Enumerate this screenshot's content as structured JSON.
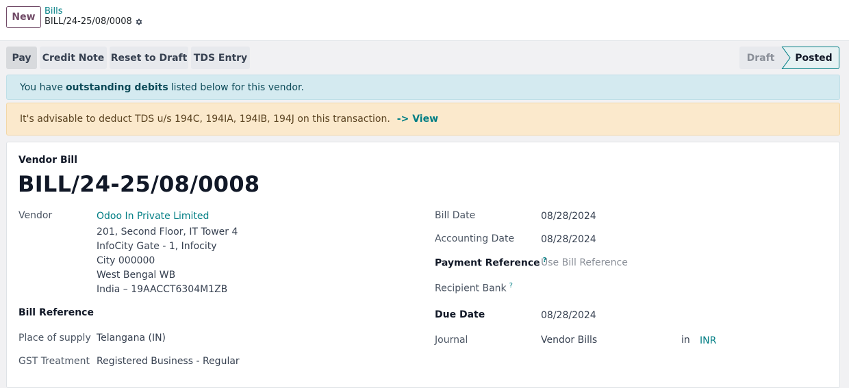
{
  "topbar": {
    "new_label": "New",
    "breadcrumb_parent": "Bills",
    "breadcrumb_current": "BILL/24-25/08/0008"
  },
  "actions": {
    "pay": "Pay",
    "credit_note": "Credit Note",
    "reset_to_draft": "Reset to Draft",
    "tds_entry": "TDS Entry"
  },
  "status": {
    "draft": "Draft",
    "posted": "Posted"
  },
  "alerts": {
    "info_prefix": "You have",
    "info_bold": "outstanding debits",
    "info_suffix": "listed below for this vendor.",
    "tds_text": "It's advisable to deduct TDS u/s 194C, 194IA, 194IB, 194J on this transaction.",
    "tds_link": "-> View"
  },
  "form": {
    "subtitle": "Vendor Bill",
    "title": "BILL/24-25/08/0008",
    "vendor_label": "Vendor",
    "vendor_name": "Odoo In Private Limited",
    "vendor_address": [
      "201, Second Floor, IT Tower 4",
      "InfoCity Gate - 1, Infocity",
      "City 000000",
      "West Bengal WB",
      "India – 19AACCT6304M1ZB"
    ],
    "bill_reference_label": "Bill Reference",
    "place_of_supply_label": "Place of supply",
    "place_of_supply": "Telangana (IN)",
    "gst_treatment_label": "GST Treatment",
    "gst_treatment": "Registered Business - Regular",
    "bill_date_label": "Bill Date",
    "bill_date": "08/28/2024",
    "accounting_date_label": "Accounting Date",
    "accounting_date": "08/28/2024",
    "payment_reference_label": "Payment Reference",
    "payment_reference_placeholder": "Use Bill Reference",
    "recipient_bank_label": "Recipient Bank",
    "due_date_label": "Due Date",
    "due_date": "08/28/2024",
    "journal_label": "Journal",
    "journal": "Vendor Bills",
    "in_label": "in",
    "currency": "INR",
    "help_marker": "?"
  },
  "colors": {
    "brand": "#714b67",
    "link": "#017e84"
  }
}
